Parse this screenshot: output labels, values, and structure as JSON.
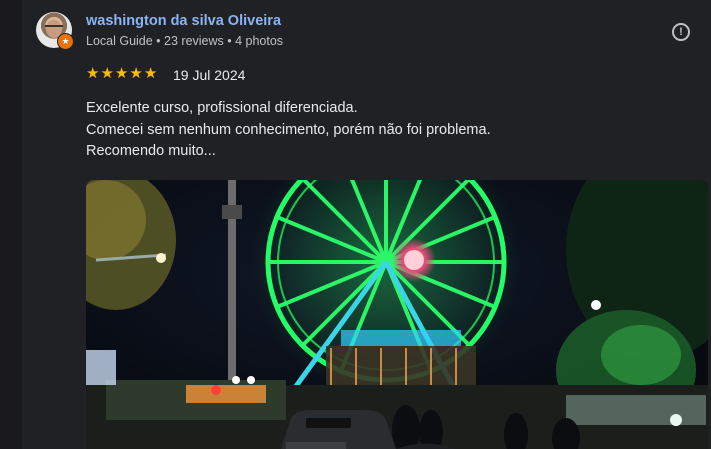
{
  "review": {
    "author_name": "washington da silva Oliveira",
    "author_meta": "Local Guide • 23 reviews • 4 photos",
    "rating": 5,
    "rating_max": 5,
    "date": "19 Jul 2024",
    "text_lines": [
      "Excelente curso, profissional diferenciada.",
      "Comecei sem nenhum conhecimento, porém não foi problema.",
      "Recomendo muito..."
    ]
  },
  "icons": {
    "report": "report-flag-icon",
    "badge": "local-guide-badge-icon",
    "star": "star-icon"
  },
  "colors": {
    "background": "#202124",
    "name": "#8ab4f8",
    "star": "#fbbc04",
    "badge": "#e8710a"
  }
}
